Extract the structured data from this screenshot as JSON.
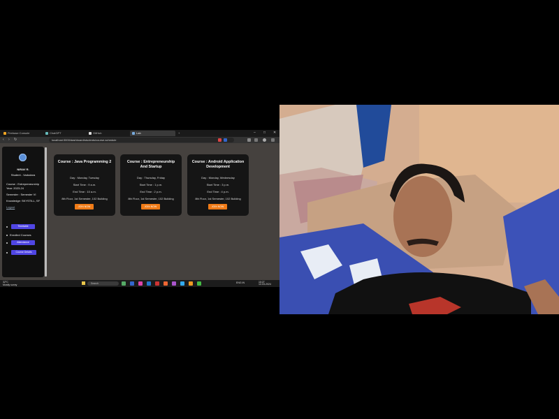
{
  "browser": {
    "tabs": [
      {
        "label": "Firebase Console"
      },
      {
        "label": "ChatGPT"
      },
      {
        "label": "GitHub"
      },
      {
        "label": "Lab"
      }
    ],
    "new_tab": "+",
    "window_controls": {
      "minimize": "–",
      "maximize": "□",
      "close": "✕"
    },
    "nav": {
      "back": "‹",
      "forward": "›",
      "reload": "↻"
    },
    "url": "localhost:3000/dashboard/students/course-schedule"
  },
  "sidebar": {
    "logo_icon": "profile-avatar-icon",
    "name": "NIRAV R.",
    "role": "Student - Vadodara",
    "details": [
      "Course : Entrepreneurship",
      "Year: 2023-24",
      "Semester : Semester VI",
      "Knowledge: SKYSTILL, SF"
    ],
    "link": "Logout",
    "buttons": [
      "Timetable",
      "Attendance",
      "Course Details"
    ],
    "bullet_texts": [
      "Enrolled Courses"
    ]
  },
  "cards": [
    {
      "title": "Course : Java Programming 2",
      "day": "Day : Monday, Tuesday",
      "start": "Start Time : 9 a.m.",
      "end": "End Time : 10 a.m.",
      "location": "8th Floor, 1st Semester, 102 Building",
      "button": "JOIN NOW"
    },
    {
      "title": "Course : Entrepreneurship And Startup",
      "day": "Day : Thursday, Friday",
      "start": "Start Time : 1 p.m.",
      "end": "End Time : 2 p.m.",
      "location": "8th Floor, 1st Semester, 102 Building",
      "button": "JOIN NOW"
    },
    {
      "title": "Course : Android Application Development",
      "day": "Day : Monday, Wednesday",
      "start": "Start Time : 3 p.m.",
      "end": "End Time : 4 p.m.",
      "location": "8th Floor, 1st Semester, 102 Building",
      "button": "JOIN NOW"
    }
  ],
  "taskbar": {
    "weather": {
      "temp": "32°C",
      "desc": "Mostly sunny"
    },
    "search_placeholder": "Search",
    "time": "10:27",
    "date": "12-03-2024",
    "lang": "ENG IN"
  },
  "colors": {
    "accent_button": "#5046e4",
    "join_button": "#f07b17",
    "page_bg": "#45413e",
    "card_bg": "#151515"
  }
}
